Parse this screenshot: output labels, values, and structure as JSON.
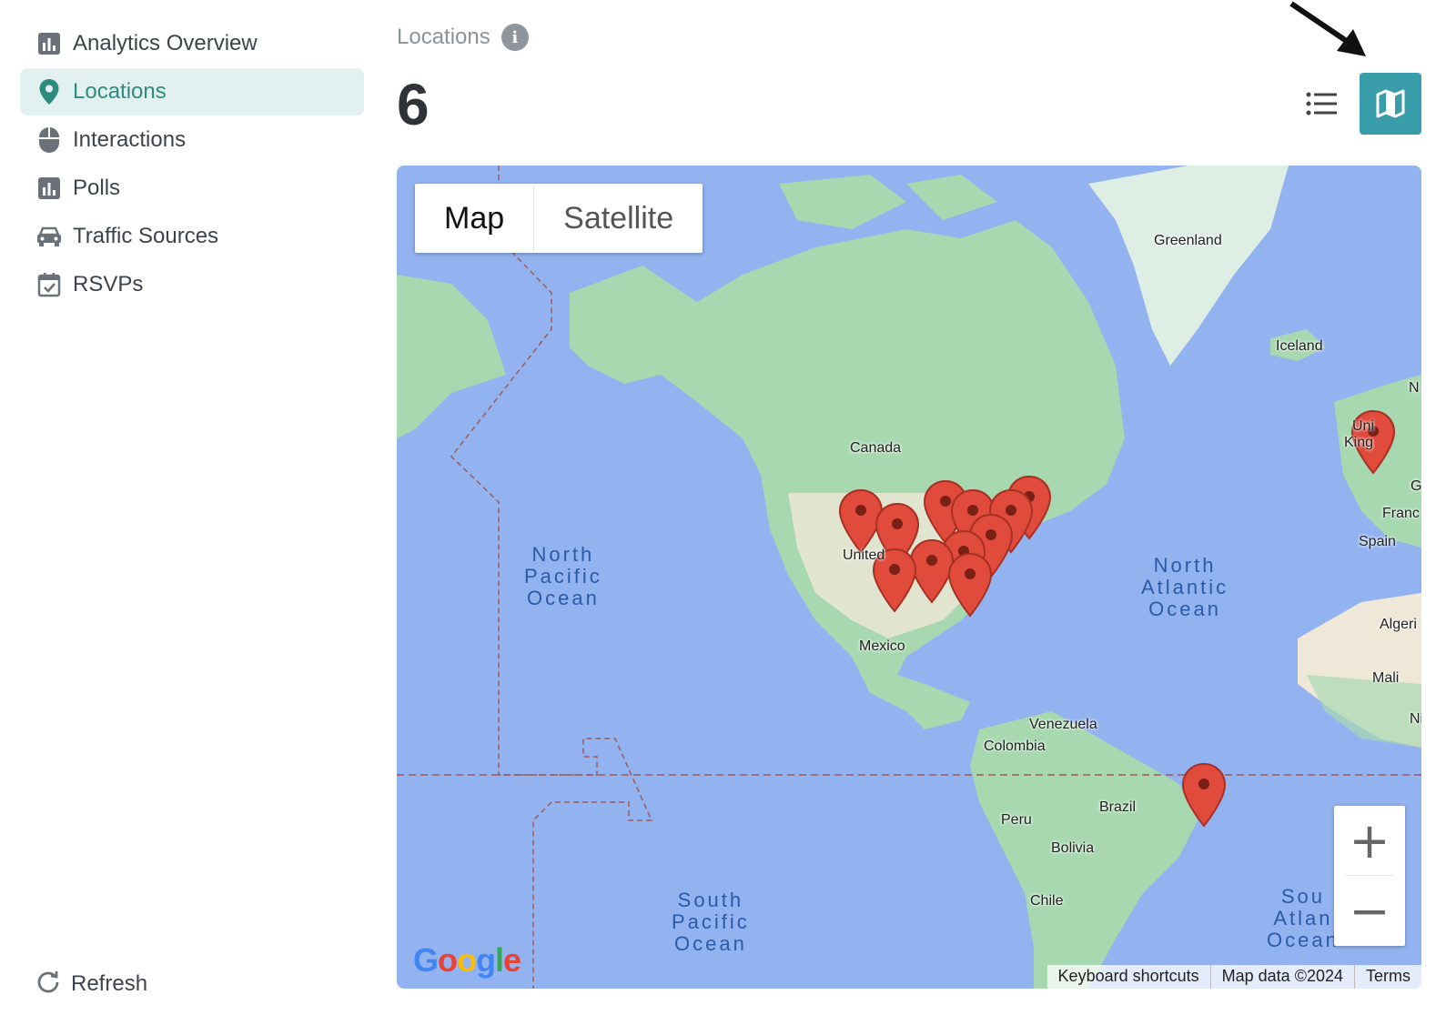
{
  "sidebar": {
    "items": [
      {
        "label": "Analytics Overview",
        "icon": "bar-chart-icon"
      },
      {
        "label": "Locations",
        "icon": "map-pin-icon",
        "active": true
      },
      {
        "label": "Interactions",
        "icon": "mouse-icon"
      },
      {
        "label": "Polls",
        "icon": "bar-chart-icon"
      },
      {
        "label": "Traffic Sources",
        "icon": "car-icon"
      },
      {
        "label": "RSVPs",
        "icon": "calendar-check-icon"
      }
    ],
    "refresh_label": "Refresh"
  },
  "header": {
    "label": "Locations",
    "count": "6"
  },
  "map": {
    "type_options": [
      "Map",
      "Satellite"
    ],
    "selected_type": "Map",
    "zoom_in": "+",
    "zoom_out": "−",
    "logo": "Google",
    "attribution": [
      "Keyboard shortcuts",
      "Map data ©2024",
      "Terms"
    ],
    "labels": {
      "greenland": "Greenland",
      "iceland": "Iceland",
      "canada": "Canada",
      "united": "United",
      "mexico": "Mexico",
      "venezuela": "Venezuela",
      "colombia": "Colombia",
      "peru": "Peru",
      "brazil": "Brazil",
      "bolivia": "Bolivia",
      "chile": "Chile",
      "spain": "Spain",
      "france": "Franc",
      "algeria": "Algeri",
      "mali": "Mali",
      "uk1": "Uni",
      "uk2": "King",
      "no": "N",
      "g": "G",
      "ni": "Ni"
    },
    "oceans": {
      "north_pacific": [
        "North",
        "Pacific",
        "Ocean"
      ],
      "north_atlantic": [
        "North",
        "Atlantic",
        "Ocean"
      ],
      "south_pacific": [
        "South",
        "Pacific",
        "Ocean"
      ],
      "south_atlantic": [
        "Sou",
        "Atlan",
        "Ocean"
      ]
    }
  },
  "colors": {
    "accent": "#3a9eaa",
    "active_text": "#2e8b80",
    "active_bg": "#e2f1ef",
    "water": "#93b3f0",
    "land": "#a8d8b0",
    "pin": "#e04b3c"
  }
}
